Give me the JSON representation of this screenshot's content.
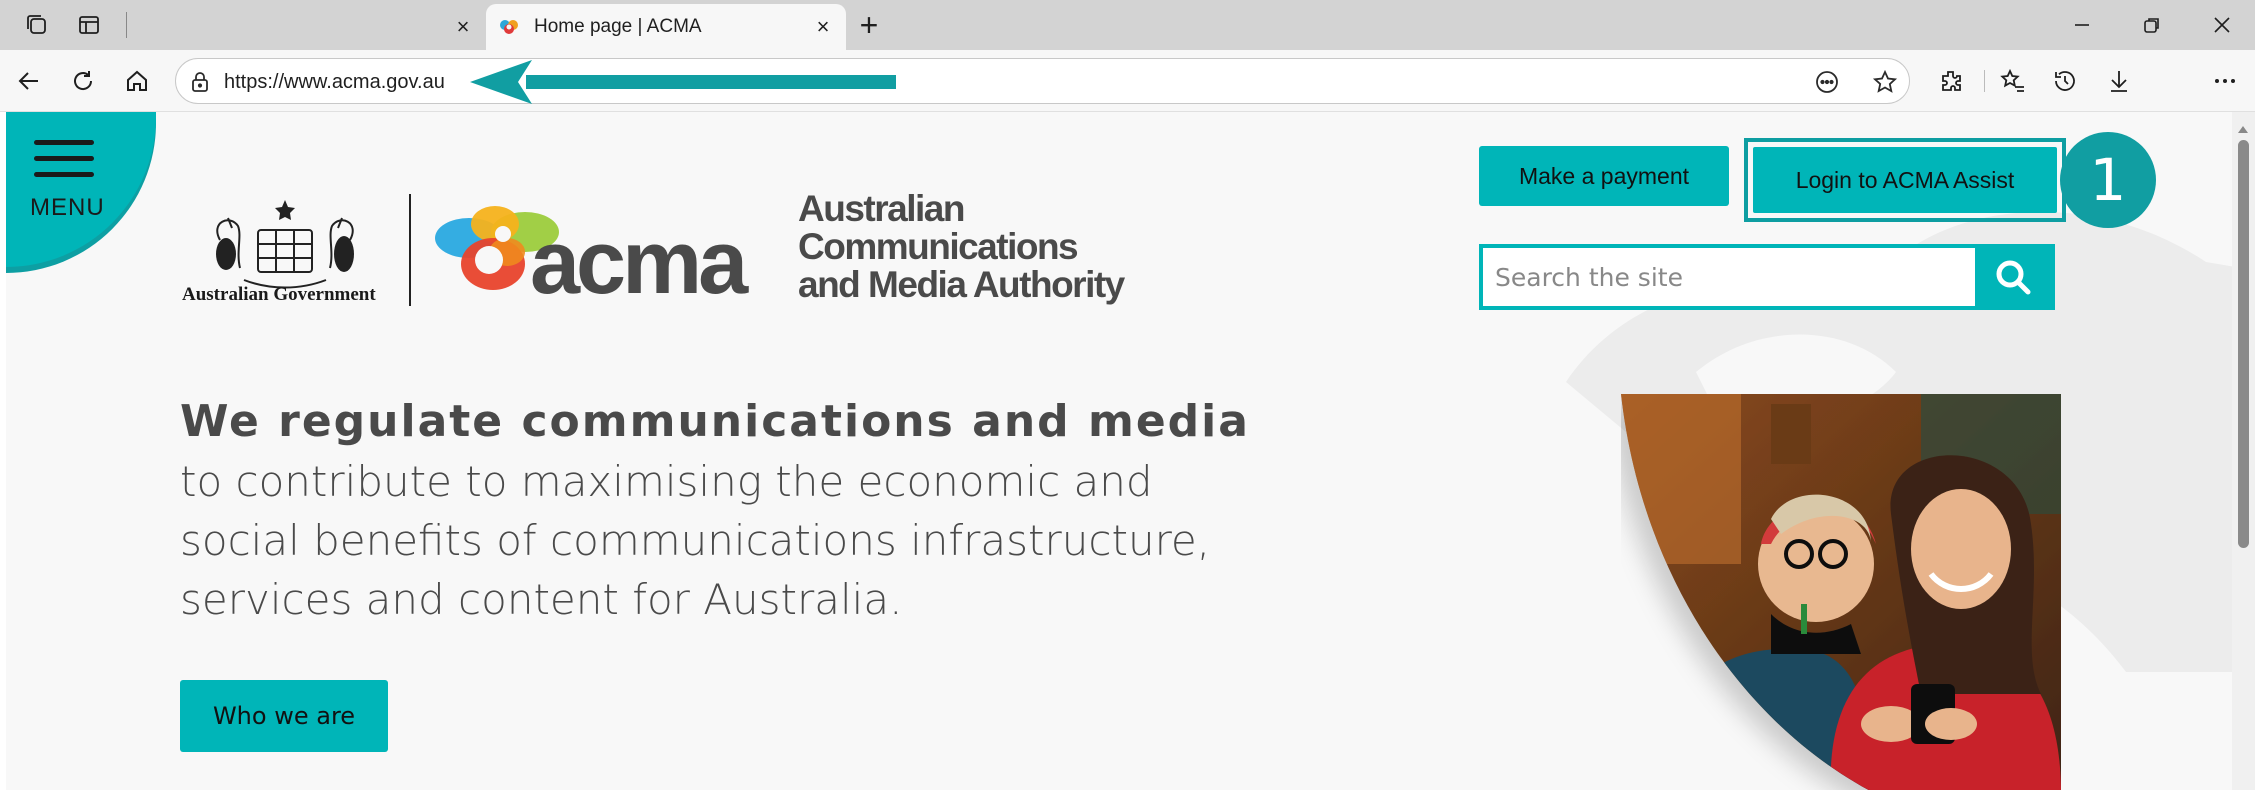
{
  "browser": {
    "tab_inactive_close": "×",
    "tab_active_title": "Home page | ACMA",
    "tab_active_close": "×",
    "new_tab": "+",
    "url": "https://www.acma.gov.au"
  },
  "page": {
    "menu_label": "MENU",
    "gov_text": "Australian Government",
    "acma_word": "acma",
    "acma_name_lines": [
      "Australian",
      "Communications",
      "and Media Authority"
    ],
    "make_payment": "Make a payment",
    "login": "Login to ACMA Assist",
    "step_number": "1",
    "search_placeholder": "Search the site",
    "hero_bold": "We regulate communications and media",
    "hero_lines": [
      "to contribute to maximising the economic and",
      "social benefits of communications infrastructure,",
      "services and content for Australia."
    ],
    "who_we_are": "Who we are"
  },
  "colors": {
    "accent": "#00b5b8",
    "accent_dark": "#119ea2",
    "text_grey": "#4a4a4a"
  }
}
